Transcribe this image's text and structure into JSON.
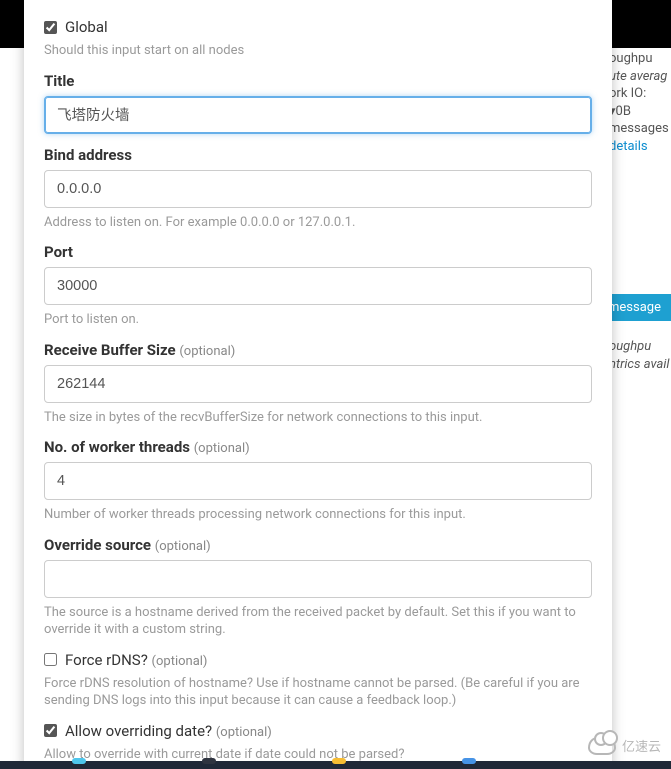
{
  "backdrop": {
    "line1": "oughpu",
    "line2": "ute averag",
    "line3": "ork IO:  ▾0B",
    "line4": " messages",
    "details_link": "details",
    "message_pill": "message",
    "line5": "oughpu",
    "line6": "ntrics avail"
  },
  "form": {
    "global": {
      "label": "Global",
      "checked": true,
      "help": "Should this input start on all nodes"
    },
    "title": {
      "label": "Title",
      "value": "飞塔防火墙"
    },
    "bind_address": {
      "label": "Bind address",
      "value": "0.0.0.0",
      "help": "Address to listen on. For example 0.0.0.0 or 127.0.0.1."
    },
    "port": {
      "label": "Port",
      "value": "30000",
      "help": "Port to listen on."
    },
    "recv_buffer": {
      "label": "Receive Buffer Size",
      "optional": "(optional)",
      "value": "262144",
      "help": "The size in bytes of the recvBufferSize for network connections to this input."
    },
    "worker_threads": {
      "label": "No. of worker threads",
      "optional": "(optional)",
      "value": "4",
      "help": "Number of worker threads processing network connections for this input."
    },
    "override_source": {
      "label": "Override source",
      "optional": "(optional)",
      "value": "",
      "help": "The source is a hostname derived from the received packet by default. Set this if you want to override it with a custom string."
    },
    "force_rdns": {
      "label": "Force rDNS?",
      "optional": "(optional)",
      "checked": false,
      "help": "Force rDNS resolution of hostname? Use if hostname cannot be parsed. (Be careful if you are sending DNS logs into this input because it can cause a feedback loop.)"
    },
    "allow_override_date": {
      "label": "Allow overriding date?",
      "optional": "(optional)",
      "checked": true,
      "help": "Allow to override with current date if date could not be parsed?"
    }
  },
  "watermark": "亿速云",
  "taskbar_colors": [
    "#4ec6ec",
    "#2f3440",
    "#f7bd33",
    "#4693e6"
  ]
}
